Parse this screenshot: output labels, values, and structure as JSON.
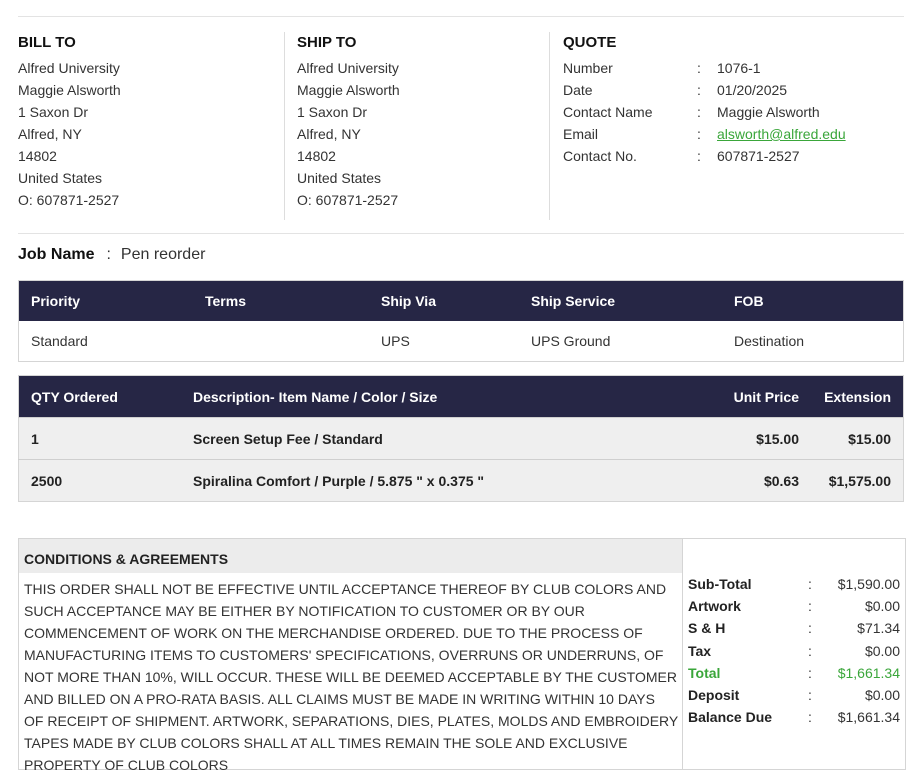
{
  "bill_to": {
    "title": "BILL TO",
    "lines": [
      "Alfred University",
      "Maggie Alsworth",
      "1 Saxon Dr",
      "Alfred, NY",
      "14802",
      "United States",
      "O: 607871-2527"
    ]
  },
  "ship_to": {
    "title": "SHIP TO",
    "lines": [
      "Alfred University",
      "Maggie Alsworth",
      "1 Saxon Dr",
      "Alfred, NY",
      "14802",
      "United States",
      "O: 607871-2527"
    ]
  },
  "quote": {
    "title": "QUOTE",
    "rows": [
      {
        "label": "Number",
        "colon": ":",
        "value": "1076-1"
      },
      {
        "label": "Date",
        "colon": ":",
        "value": "01/20/2025"
      },
      {
        "label": "Contact Name",
        "colon": ":",
        "value": "Maggie Alsworth"
      },
      {
        "label": "Email",
        "colon": ":",
        "value": "alsworth@alfred.edu"
      },
      {
        "label": "Contact No.",
        "colon": ":",
        "value": "607871-2527"
      }
    ],
    "link_color": "#3aa63a"
  },
  "job": {
    "label": "Job Name",
    "colon": ":",
    "value": "Pen reorder"
  },
  "shipping_table": {
    "headers": [
      "Priority",
      "Terms",
      "Ship Via",
      "Ship Service",
      "FOB"
    ],
    "row": [
      "Standard",
      "",
      "UPS",
      "UPS Ground",
      "Destination"
    ]
  },
  "items_table": {
    "headers": [
      "QTY Ordered",
      "Description- Item Name / Color / Size",
      "Unit Price",
      "Extension"
    ],
    "rows": [
      [
        "1",
        "Screen Setup Fee / Standard",
        "$15.00",
        "$15.00"
      ],
      [
        "2500",
        "Spiralina Comfort / Purple / 5.875 \" x 0.375 \"",
        "$0.63",
        "$1,575.00"
      ]
    ],
    "header_bg": "#262645"
  },
  "conditions": {
    "title": "CONDITIONS & AGREEMENTS",
    "text": "THIS ORDER SHALL NOT BE EFFECTIVE UNTIL ACCEPTANCE THEREOF BY CLUB COLORS AND SUCH ACCEPTANCE MAY BE EITHER BY NOTIFICATION TO CUSTOMER OR BY OUR COMMENCEMENT OF WORK ON THE MERCHANDISE ORDERED. DUE TO THE PROCESS OF MANUFACTURING ITEMS TO CUSTOMERS' SPECIFICATIONS, OVERRUNS OR UNDERRUNS, OF NOT MORE THAN 10%, WILL OCCUR. THESE WILL BE DEEMED ACCEPTABLE BY THE CUSTOMER AND BILLED ON A PRO-RATA BASIS. ALL CLAIMS MUST BE MADE IN WRITING WITHIN 10 DAYS OF RECEIPT OF SHIPMENT. ARTWORK, SEPARATIONS, DIES, PLATES, MOLDS AND EMBROIDERY TAPES MADE BY CLUB COLORS SHALL AT ALL TIMES REMAIN THE SOLE AND EXCLUSIVE PROPERTY OF CLUB COLORS"
  },
  "totals": [
    {
      "label": "Sub-Total",
      "colon": ":",
      "value": "$1,590.00"
    },
    {
      "label": "Artwork",
      "colon": ":",
      "value": "$0.00"
    },
    {
      "label": "S & H",
      "colon": ":",
      "value": "$71.34"
    },
    {
      "label": "Tax",
      "colon": ":",
      "value": "$0.00"
    },
    {
      "label": "Total",
      "colon": ":",
      "value": "$1,661.34"
    },
    {
      "label": "Deposit",
      "colon": ":",
      "value": "$0.00"
    },
    {
      "label": "Balance Due",
      "colon": ":",
      "value": "$1,661.34"
    }
  ],
  "total_color": "#3aa63a"
}
